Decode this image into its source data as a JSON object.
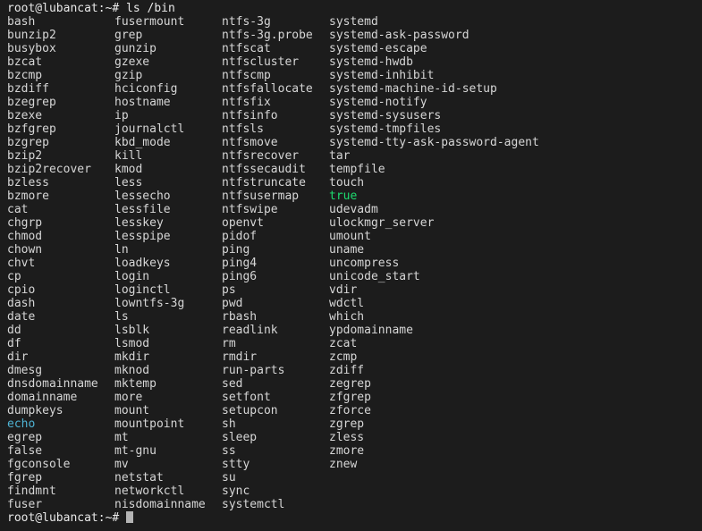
{
  "terminal": {
    "background_color": "#1c1c1c",
    "default_text_color": "#d6d6d6",
    "green_color": "#1ddb6f",
    "cyan_color": "#4eb3d4",
    "prompt_top": "root@lubancat:~# ls /bin",
    "prompt_bottom": "root@lubancat:~# ",
    "cursor": "block-cursor"
  },
  "listing": {
    "columns": [
      {
        "name": "column-1",
        "entries": [
          {
            "text": "bash",
            "color": "white"
          },
          {
            "text": "bunzip2",
            "color": "white"
          },
          {
            "text": "busybox",
            "color": "white"
          },
          {
            "text": "bzcat",
            "color": "white"
          },
          {
            "text": "bzcmp",
            "color": "white"
          },
          {
            "text": "bzdiff",
            "color": "white"
          },
          {
            "text": "bzegrep",
            "color": "white"
          },
          {
            "text": "bzexe",
            "color": "white"
          },
          {
            "text": "bzfgrep",
            "color": "white"
          },
          {
            "text": "bzgrep",
            "color": "white"
          },
          {
            "text": "bzip2",
            "color": "white"
          },
          {
            "text": "bzip2recover",
            "color": "white"
          },
          {
            "text": "bzless",
            "color": "white"
          },
          {
            "text": "bzmore",
            "color": "white"
          },
          {
            "text": "cat",
            "color": "white"
          },
          {
            "text": "chgrp",
            "color": "white"
          },
          {
            "text": "chmod",
            "color": "white"
          },
          {
            "text": "chown",
            "color": "white"
          },
          {
            "text": "chvt",
            "color": "white"
          },
          {
            "text": "cp",
            "color": "white"
          },
          {
            "text": "cpio",
            "color": "white"
          },
          {
            "text": "dash",
            "color": "white"
          },
          {
            "text": "date",
            "color": "white"
          },
          {
            "text": "dd",
            "color": "white"
          },
          {
            "text": "df",
            "color": "white"
          },
          {
            "text": "dir",
            "color": "white"
          },
          {
            "text": "dmesg",
            "color": "white"
          },
          {
            "text": "dnsdomainname",
            "color": "white"
          },
          {
            "text": "domainname",
            "color": "white"
          },
          {
            "text": "dumpkeys",
            "color": "white"
          },
          {
            "text": "echo",
            "color": "cyan"
          },
          {
            "text": "egrep",
            "color": "white"
          },
          {
            "text": "false",
            "color": "white"
          },
          {
            "text": "fgconsole",
            "color": "white"
          },
          {
            "text": "fgrep",
            "color": "white"
          },
          {
            "text": "findmnt",
            "color": "white"
          },
          {
            "text": "fuser",
            "color": "white"
          }
        ]
      },
      {
        "name": "column-2",
        "entries": [
          {
            "text": "fusermount",
            "color": "white"
          },
          {
            "text": "grep",
            "color": "white"
          },
          {
            "text": "gunzip",
            "color": "white"
          },
          {
            "text": "gzexe",
            "color": "white"
          },
          {
            "text": "gzip",
            "color": "white"
          },
          {
            "text": "hciconfig",
            "color": "white"
          },
          {
            "text": "hostname",
            "color": "white"
          },
          {
            "text": "ip",
            "color": "white"
          },
          {
            "text": "journalctl",
            "color": "white"
          },
          {
            "text": "kbd_mode",
            "color": "white"
          },
          {
            "text": "kill",
            "color": "white"
          },
          {
            "text": "kmod",
            "color": "white"
          },
          {
            "text": "less",
            "color": "white"
          },
          {
            "text": "lessecho",
            "color": "white"
          },
          {
            "text": "lessfile",
            "color": "white"
          },
          {
            "text": "lesskey",
            "color": "white"
          },
          {
            "text": "lesspipe",
            "color": "white"
          },
          {
            "text": "ln",
            "color": "white"
          },
          {
            "text": "loadkeys",
            "color": "white"
          },
          {
            "text": "login",
            "color": "white"
          },
          {
            "text": "loginctl",
            "color": "white"
          },
          {
            "text": "lowntfs-3g",
            "color": "white"
          },
          {
            "text": "ls",
            "color": "white"
          },
          {
            "text": "lsblk",
            "color": "white"
          },
          {
            "text": "lsmod",
            "color": "white"
          },
          {
            "text": "mkdir",
            "color": "white"
          },
          {
            "text": "mknod",
            "color": "white"
          },
          {
            "text": "mktemp",
            "color": "white"
          },
          {
            "text": "more",
            "color": "white"
          },
          {
            "text": "mount",
            "color": "white"
          },
          {
            "text": "mountpoint",
            "color": "white"
          },
          {
            "text": "mt",
            "color": "white"
          },
          {
            "text": "mt-gnu",
            "color": "white"
          },
          {
            "text": "mv",
            "color": "white"
          },
          {
            "text": "netstat",
            "color": "white"
          },
          {
            "text": "networkctl",
            "color": "white"
          },
          {
            "text": "nisdomainname",
            "color": "white"
          }
        ]
      },
      {
        "name": "column-3",
        "entries": [
          {
            "text": "ntfs-3g",
            "color": "white"
          },
          {
            "text": "ntfs-3g.probe",
            "color": "white"
          },
          {
            "text": "ntfscat",
            "color": "white"
          },
          {
            "text": "ntfscluster",
            "color": "white"
          },
          {
            "text": "ntfscmp",
            "color": "white"
          },
          {
            "text": "ntfsfallocate",
            "color": "white"
          },
          {
            "text": "ntfsfix",
            "color": "white"
          },
          {
            "text": "ntfsinfo",
            "color": "white"
          },
          {
            "text": "ntfsls",
            "color": "white"
          },
          {
            "text": "ntfsmove",
            "color": "white"
          },
          {
            "text": "ntfsrecover",
            "color": "white"
          },
          {
            "text": "ntfssecaudit",
            "color": "white"
          },
          {
            "text": "ntfstruncate",
            "color": "white"
          },
          {
            "text": "ntfsusermap",
            "color": "white"
          },
          {
            "text": "ntfswipe",
            "color": "white"
          },
          {
            "text": "openvt",
            "color": "white"
          },
          {
            "text": "pidof",
            "color": "white"
          },
          {
            "text": "ping",
            "color": "white"
          },
          {
            "text": "ping4",
            "color": "white"
          },
          {
            "text": "ping6",
            "color": "white"
          },
          {
            "text": "ps",
            "color": "white"
          },
          {
            "text": "pwd",
            "color": "white"
          },
          {
            "text": "rbash",
            "color": "white"
          },
          {
            "text": "readlink",
            "color": "white"
          },
          {
            "text": "rm",
            "color": "white"
          },
          {
            "text": "rmdir",
            "color": "white"
          },
          {
            "text": "run-parts",
            "color": "white"
          },
          {
            "text": "sed",
            "color": "white"
          },
          {
            "text": "setfont",
            "color": "white"
          },
          {
            "text": "setupcon",
            "color": "white"
          },
          {
            "text": "sh",
            "color": "white"
          },
          {
            "text": "sleep",
            "color": "white"
          },
          {
            "text": "ss",
            "color": "white"
          },
          {
            "text": "stty",
            "color": "white"
          },
          {
            "text": "su",
            "color": "white"
          },
          {
            "text": "sync",
            "color": "white"
          },
          {
            "text": "systemctl",
            "color": "white"
          }
        ]
      },
      {
        "name": "column-4",
        "entries": [
          {
            "text": "systemd",
            "color": "white"
          },
          {
            "text": "systemd-ask-password",
            "color": "white"
          },
          {
            "text": "systemd-escape",
            "color": "white"
          },
          {
            "text": "systemd-hwdb",
            "color": "white"
          },
          {
            "text": "systemd-inhibit",
            "color": "white"
          },
          {
            "text": "systemd-machine-id-setup",
            "color": "white"
          },
          {
            "text": "systemd-notify",
            "color": "white"
          },
          {
            "text": "systemd-sysusers",
            "color": "white"
          },
          {
            "text": "systemd-tmpfiles",
            "color": "white"
          },
          {
            "text": "systemd-tty-ask-password-agent",
            "color": "white"
          },
          {
            "text": "tar",
            "color": "white"
          },
          {
            "text": "tempfile",
            "color": "white"
          },
          {
            "text": "touch",
            "color": "white"
          },
          {
            "text": "true",
            "color": "green"
          },
          {
            "text": "udevadm",
            "color": "white"
          },
          {
            "text": "ulockmgr_server",
            "color": "white"
          },
          {
            "text": "umount",
            "color": "white"
          },
          {
            "text": "uname",
            "color": "white"
          },
          {
            "text": "uncompress",
            "color": "white"
          },
          {
            "text": "unicode_start",
            "color": "white"
          },
          {
            "text": "vdir",
            "color": "white"
          },
          {
            "text": "wdctl",
            "color": "white"
          },
          {
            "text": "which",
            "color": "white"
          },
          {
            "text": "ypdomainname",
            "color": "white"
          },
          {
            "text": "zcat",
            "color": "white"
          },
          {
            "text": "zcmp",
            "color": "white"
          },
          {
            "text": "zdiff",
            "color": "white"
          },
          {
            "text": "zegrep",
            "color": "white"
          },
          {
            "text": "zfgrep",
            "color": "white"
          },
          {
            "text": "zforce",
            "color": "white"
          },
          {
            "text": "zgrep",
            "color": "white"
          },
          {
            "text": "zless",
            "color": "white"
          },
          {
            "text": "zmore",
            "color": "white"
          },
          {
            "text": "znew",
            "color": "white"
          }
        ]
      }
    ]
  }
}
